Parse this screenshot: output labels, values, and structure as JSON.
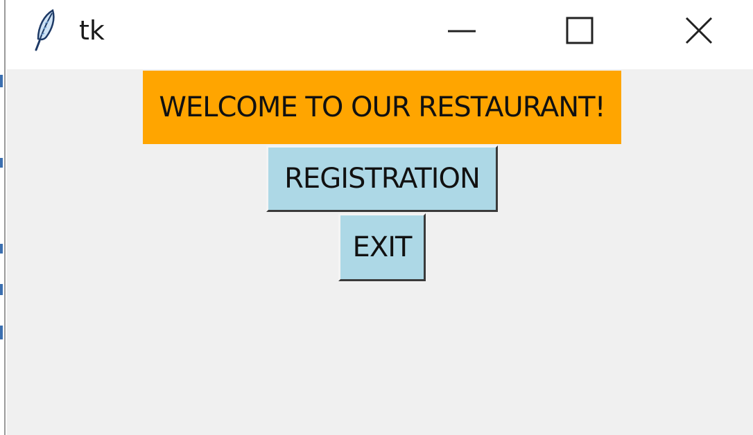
{
  "window": {
    "title": "tk"
  },
  "main": {
    "banner_text": "WELCOME TO OUR RESTAURANT!",
    "registration_label": "REGISTRATION",
    "exit_label": "EXIT"
  },
  "icons": {
    "app": "feather-icon",
    "minimize": "minimize-icon",
    "maximize": "maximize-icon",
    "close": "close-icon"
  },
  "colors": {
    "banner_bg": "#ffa500",
    "button_bg": "#add8e6",
    "window_bg": "#f0f0f0",
    "titlebar_bg": "#ffffff"
  }
}
